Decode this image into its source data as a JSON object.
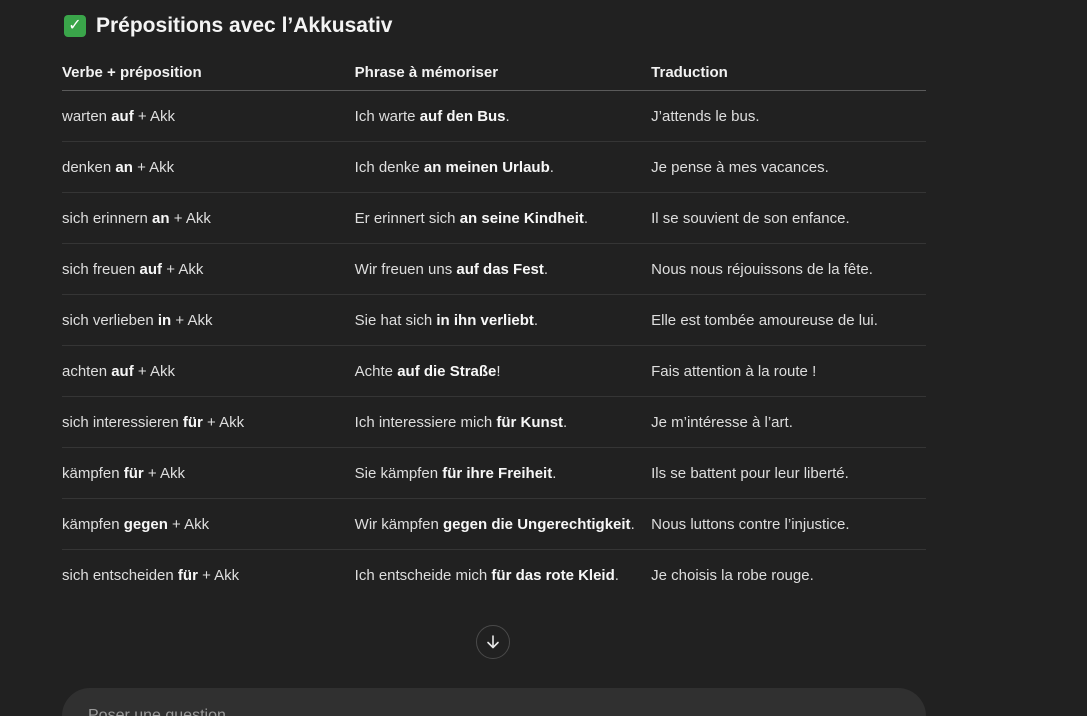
{
  "section": {
    "title": "Prépositions avec l’Akkusativ",
    "icon": "check-mark-icon"
  },
  "table": {
    "headers": [
      "Verbe + préposition",
      "Phrase à mémoriser",
      "Traduction"
    ],
    "rows": [
      {
        "verb": [
          {
            "t": "warten "
          },
          {
            "t": "auf",
            "b": true
          },
          {
            "t": " + Akk"
          }
        ],
        "phrase": [
          {
            "t": "Ich warte "
          },
          {
            "t": "auf den Bus",
            "b": true
          },
          {
            "t": "."
          }
        ],
        "translation": "J’attends le bus."
      },
      {
        "verb": [
          {
            "t": "denken "
          },
          {
            "t": "an",
            "b": true
          },
          {
            "t": " + Akk"
          }
        ],
        "phrase": [
          {
            "t": "Ich denke "
          },
          {
            "t": "an meinen Urlaub",
            "b": true
          },
          {
            "t": "."
          }
        ],
        "translation": "Je pense à mes vacances."
      },
      {
        "verb": [
          {
            "t": "sich erinnern "
          },
          {
            "t": "an",
            "b": true
          },
          {
            "t": " + Akk"
          }
        ],
        "phrase": [
          {
            "t": "Er erinnert sich "
          },
          {
            "t": "an seine Kindheit",
            "b": true
          },
          {
            "t": "."
          }
        ],
        "translation": "Il se souvient de son enfance."
      },
      {
        "verb": [
          {
            "t": "sich freuen "
          },
          {
            "t": "auf",
            "b": true
          },
          {
            "t": " + Akk"
          }
        ],
        "phrase": [
          {
            "t": "Wir freuen uns "
          },
          {
            "t": "auf das Fest",
            "b": true
          },
          {
            "t": "."
          }
        ],
        "translation": "Nous nous réjouissons de la fête."
      },
      {
        "verb": [
          {
            "t": "sich verlieben "
          },
          {
            "t": "in",
            "b": true
          },
          {
            "t": " + Akk"
          }
        ],
        "phrase": [
          {
            "t": "Sie hat sich "
          },
          {
            "t": "in ihn verliebt",
            "b": true
          },
          {
            "t": "."
          }
        ],
        "translation": "Elle est tombée amoureuse de lui."
      },
      {
        "verb": [
          {
            "t": "achten "
          },
          {
            "t": "auf",
            "b": true
          },
          {
            "t": " + Akk"
          }
        ],
        "phrase": [
          {
            "t": "Achte "
          },
          {
            "t": "auf die Straße",
            "b": true
          },
          {
            "t": "!"
          }
        ],
        "translation": "Fais attention à la route !"
      },
      {
        "verb": [
          {
            "t": "sich interessieren "
          },
          {
            "t": "für",
            "b": true
          },
          {
            "t": " + Akk"
          }
        ],
        "phrase": [
          {
            "t": "Ich interessiere mich "
          },
          {
            "t": "für Kunst",
            "b": true
          },
          {
            "t": "."
          }
        ],
        "translation": "Je m’intéresse à l’art."
      },
      {
        "verb": [
          {
            "t": "kämpfen "
          },
          {
            "t": "für",
            "b": true
          },
          {
            "t": " + Akk"
          }
        ],
        "phrase": [
          {
            "t": "Sie kämpfen "
          },
          {
            "t": "für ihre Freiheit",
            "b": true
          },
          {
            "t": "."
          }
        ],
        "translation": "Ils se battent pour leur liberté."
      },
      {
        "verb": [
          {
            "t": "kämpfen "
          },
          {
            "t": "gegen",
            "b": true
          },
          {
            "t": " + Akk"
          }
        ],
        "phrase": [
          {
            "t": "Wir kämpfen "
          },
          {
            "t": "gegen die Ungerechtigkeit",
            "b": true
          },
          {
            "t": "."
          }
        ],
        "translation": "Nous luttons contre l’injustice."
      },
      {
        "verb": [
          {
            "t": "sich entscheiden "
          },
          {
            "t": "für",
            "b": true
          },
          {
            "t": " + Akk"
          }
        ],
        "phrase": [
          {
            "t": "Ich entscheide mich "
          },
          {
            "t": "für das rote Kleid",
            "b": true
          },
          {
            "t": "."
          }
        ],
        "translation": "Je choisis la robe rouge."
      }
    ]
  },
  "scroll_button": {
    "icon": "arrow-down-icon"
  },
  "composer": {
    "placeholder": "Poser une question"
  }
}
